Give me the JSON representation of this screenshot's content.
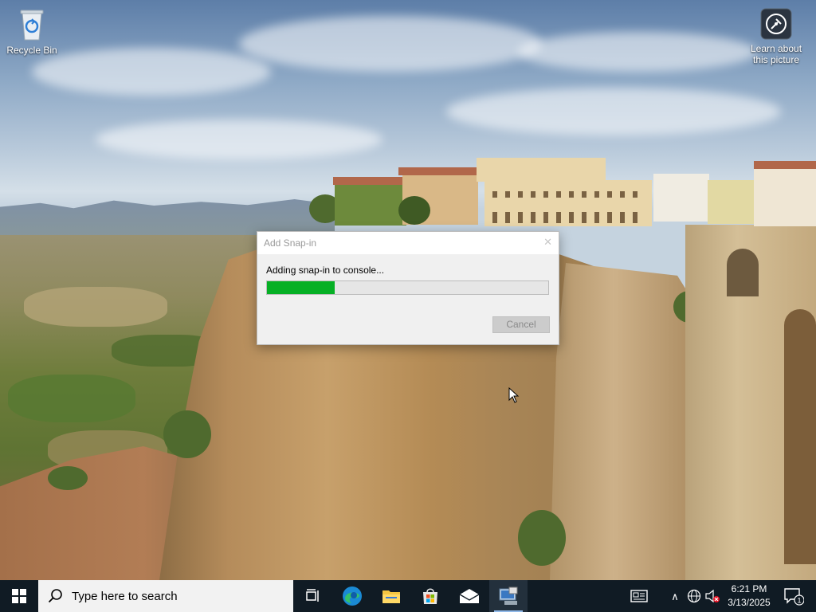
{
  "desktop": {
    "icons": [
      {
        "label": "Recycle Bin",
        "icon": "recycle-bin-icon"
      },
      {
        "label": "Learn about this picture",
        "icon": "learn-picture-icon"
      }
    ]
  },
  "dialog": {
    "title": "Add Snap-in",
    "close_glyph": "✕",
    "message": "Adding snap-in to console...",
    "progress_fraction": 0.24,
    "progress_color": "#06b025",
    "cancel_label": "Cancel",
    "cancel_enabled": false
  },
  "taskbar": {
    "search_placeholder": "Type here to search",
    "apps": [
      {
        "name": "task-view",
        "icon": "task-view-icon"
      },
      {
        "name": "edge",
        "icon": "edge-icon"
      },
      {
        "name": "file-explorer",
        "icon": "folder-icon"
      },
      {
        "name": "microsoft-store",
        "icon": "store-icon"
      },
      {
        "name": "mail",
        "icon": "mail-icon"
      },
      {
        "name": "mmc",
        "icon": "mmc-console-icon",
        "active": true
      }
    ],
    "tray": {
      "news_icon": "news-widget-icon",
      "chevron_glyph": "∧",
      "time": "6:21 PM",
      "date": "3/13/2025",
      "notification_count": "1"
    }
  },
  "colors": {
    "taskbar_bg": "#101b24",
    "accent_underline": "#8fb8e8"
  }
}
